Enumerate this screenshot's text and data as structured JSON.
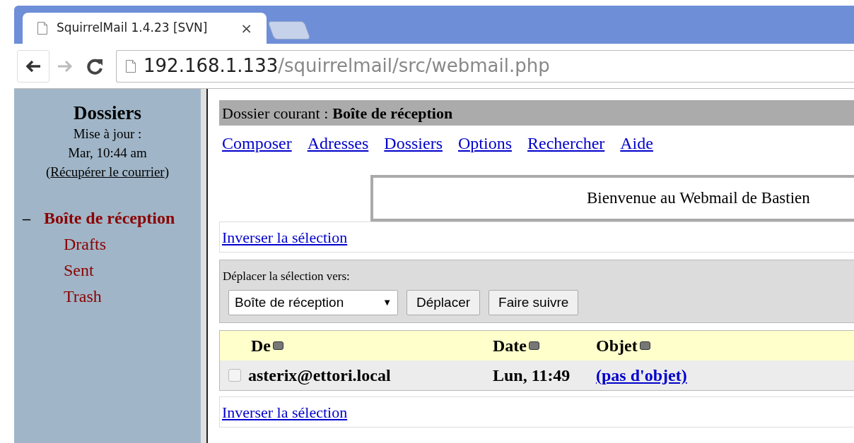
{
  "browser": {
    "tab_title": "SquirrelMail 1.4.23 [SVN]",
    "tab_close": "×",
    "address_host": "192.168.1.133",
    "address_path": "/squirrelmail/src/webmail.php"
  },
  "sidebar": {
    "title": "Dossiers",
    "updated_label": "Mise à jour :",
    "updated_time": "Mar, 10:44 am",
    "check_mail_prefix": "(",
    "check_mail": "Récupérer le courrier",
    "check_mail_suffix": ")",
    "folders": [
      {
        "label": "Boîte de réception",
        "toggle": "–",
        "selected": true,
        "expanded": true,
        "children": [
          {
            "label": "Drafts",
            "selected": false
          },
          {
            "label": "Sent",
            "selected": false
          },
          {
            "label": "Trash",
            "selected": false
          }
        ]
      }
    ]
  },
  "main": {
    "current_folder_label": "Dossier courant :",
    "current_folder": "Boîte de réception",
    "menu": [
      "Composer",
      "Adresses",
      "Dossiers",
      "Options",
      "Rechercher",
      "Aide"
    ],
    "welcome": "Bienvenue au Webmail de Bastien",
    "toggle_selection_top": "Inverser la sélection",
    "move_label": "Déplacer la sélection vers:",
    "move_target": "Boîte de réception",
    "move_dropdown_arrow": "▼",
    "buttons": [
      "Déplacer",
      "Faire suivre"
    ],
    "columns": [
      "De",
      "Date",
      "Objet"
    ],
    "rows": [
      {
        "from": "asterix@ettori.local",
        "date": "Lun, 11:49",
        "subject": "(pas d'objet)",
        "checked": false
      }
    ],
    "toggle_selection_bottom": "Inverser la sélection"
  }
}
